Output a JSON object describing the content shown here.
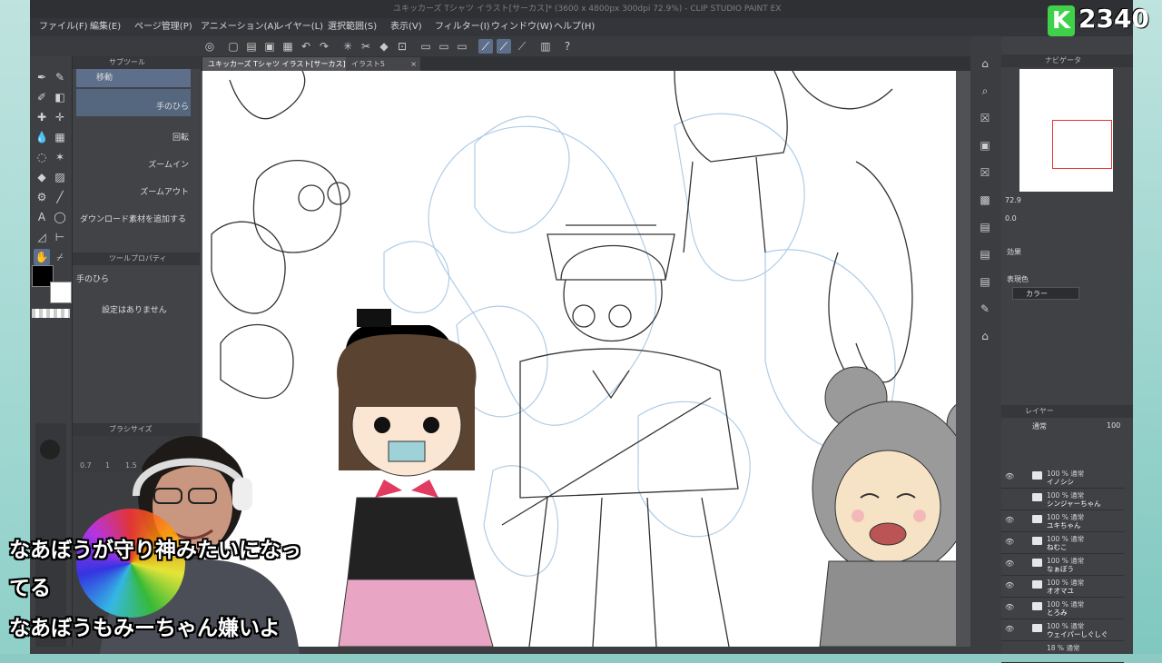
{
  "window": {
    "title": "ユキッカーズ Tシャツ イラスト[サーカス]* (3600 x 4800px 300dpi 72.9%) - CLIP STUDIO PAINT EX"
  },
  "menu": [
    "ファイル(F)",
    "編集(E)",
    "ページ管理(P)",
    "アニメーション(A)",
    "レイヤー(L)",
    "選択範囲(S)",
    "表示(V)",
    "フィルター(I)",
    "ウィンドウ(W)",
    "ヘルプ(H)"
  ],
  "tabs": [
    "ユキッカーズ Tシャツ イラスト[サーカス]*",
    "イラスト5"
  ],
  "subtool": {
    "header": "サブツール",
    "items": [
      "移動",
      "手のひら",
      "回転",
      "ズームイン",
      "ズームアウト"
    ],
    "add_material": "ダウンロード素材を追加する"
  },
  "tool_property": {
    "header": "ツールプロパティ",
    "name": "手のひら",
    "empty_note": "設定はありません"
  },
  "brush_size": {
    "header": "ブラシサイズ",
    "values": [
      "0.7",
      "1",
      "1.5"
    ]
  },
  "navigator": {
    "header": "ナビゲータ",
    "zoom": "72.9",
    "angle": "0.0"
  },
  "effect_panel": {
    "label": "効果",
    "expression_label": "表現色",
    "expression_value": "カラー"
  },
  "layer_panel": {
    "header": "レイヤー",
    "blend_mode": "通常",
    "opacity": "100",
    "layers": [
      {
        "opacity": "100 % 通常",
        "name": "イノシシ"
      },
      {
        "opacity": "100 % 通常",
        "name": "シンジャーちゃん"
      },
      {
        "opacity": "100 % 通常",
        "name": "ユキちゃん"
      },
      {
        "opacity": "100 % 通常",
        "name": "ねむこ"
      },
      {
        "opacity": "100 % 通常",
        "name": "なぁぼう"
      },
      {
        "opacity": "100 % 通常",
        "name": "オオマユ"
      },
      {
        "opacity": "100 % 通常",
        "name": "とろみ"
      },
      {
        "opacity": "100 % 通常",
        "name": "ウェイパーしぐしぐ"
      },
      {
        "opacity": "18 % 通常",
        "name": ""
      }
    ]
  },
  "stream_badge": {
    "letter": "K",
    "count": "2340",
    "color": "#3fd14a"
  },
  "subtitles": [
    "なあぼうが守り神みたいになっ",
    "てる",
    "なあぼうもみーちゃん嫌いよ"
  ],
  "colors": {
    "accent": "#5d6f8a",
    "sketch": "#9cc0e0",
    "ink": "#333333"
  }
}
